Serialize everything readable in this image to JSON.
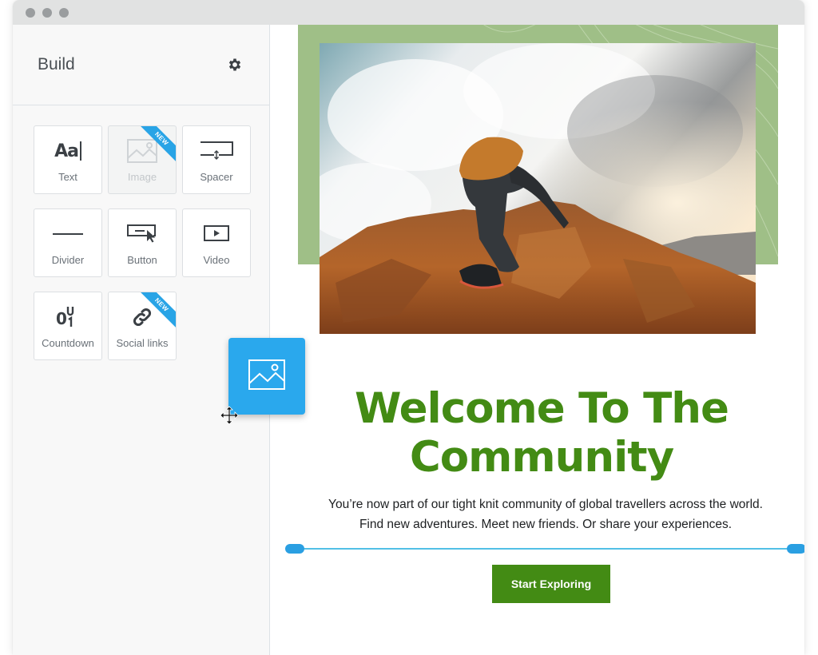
{
  "window": {
    "controls": [
      "close",
      "minimize",
      "maximize"
    ]
  },
  "sidebar": {
    "title": "Build",
    "settings_icon": "gear-icon",
    "tiles": [
      {
        "label": "Text",
        "icon": "text-aa-icon",
        "badge": null,
        "state": "normal"
      },
      {
        "label": "Image",
        "icon": "image-icon",
        "badge": "NEW",
        "state": "dragging"
      },
      {
        "label": "Spacer",
        "icon": "spacer-icon",
        "badge": null,
        "state": "normal"
      },
      {
        "label": "Divider",
        "icon": "divider-icon",
        "badge": null,
        "state": "normal"
      },
      {
        "label": "Button",
        "icon": "button-icon",
        "badge": null,
        "state": "normal"
      },
      {
        "label": "Video",
        "icon": "video-icon",
        "badge": null,
        "state": "normal"
      },
      {
        "label": "Countdown",
        "icon": "countdown-icon",
        "badge": null,
        "state": "normal"
      },
      {
        "label": "Social links",
        "icon": "link-icon",
        "badge": "NEW",
        "state": "normal"
      }
    ],
    "text_icon_glyph": "Aa"
  },
  "drag": {
    "item": "Image",
    "icon": "image-icon",
    "cursor": "move-cursor-icon"
  },
  "canvas": {
    "hero_image_alt": "Hiker climbing rocky mountain summit",
    "headline": "Welcome To The Community",
    "body": "You’re now part of our tight knit community of global travellers across the world. Find new adventures. Meet new friends. Or share your experiences.",
    "cta_label": "Start Exploring"
  },
  "colors": {
    "brand_green": "#438b14",
    "accent_green_bg": "#9fbf87",
    "drag_blue": "#2aa8ed",
    "badge_blue": "#29a4e6",
    "divider_blue": "#52c0e6"
  }
}
